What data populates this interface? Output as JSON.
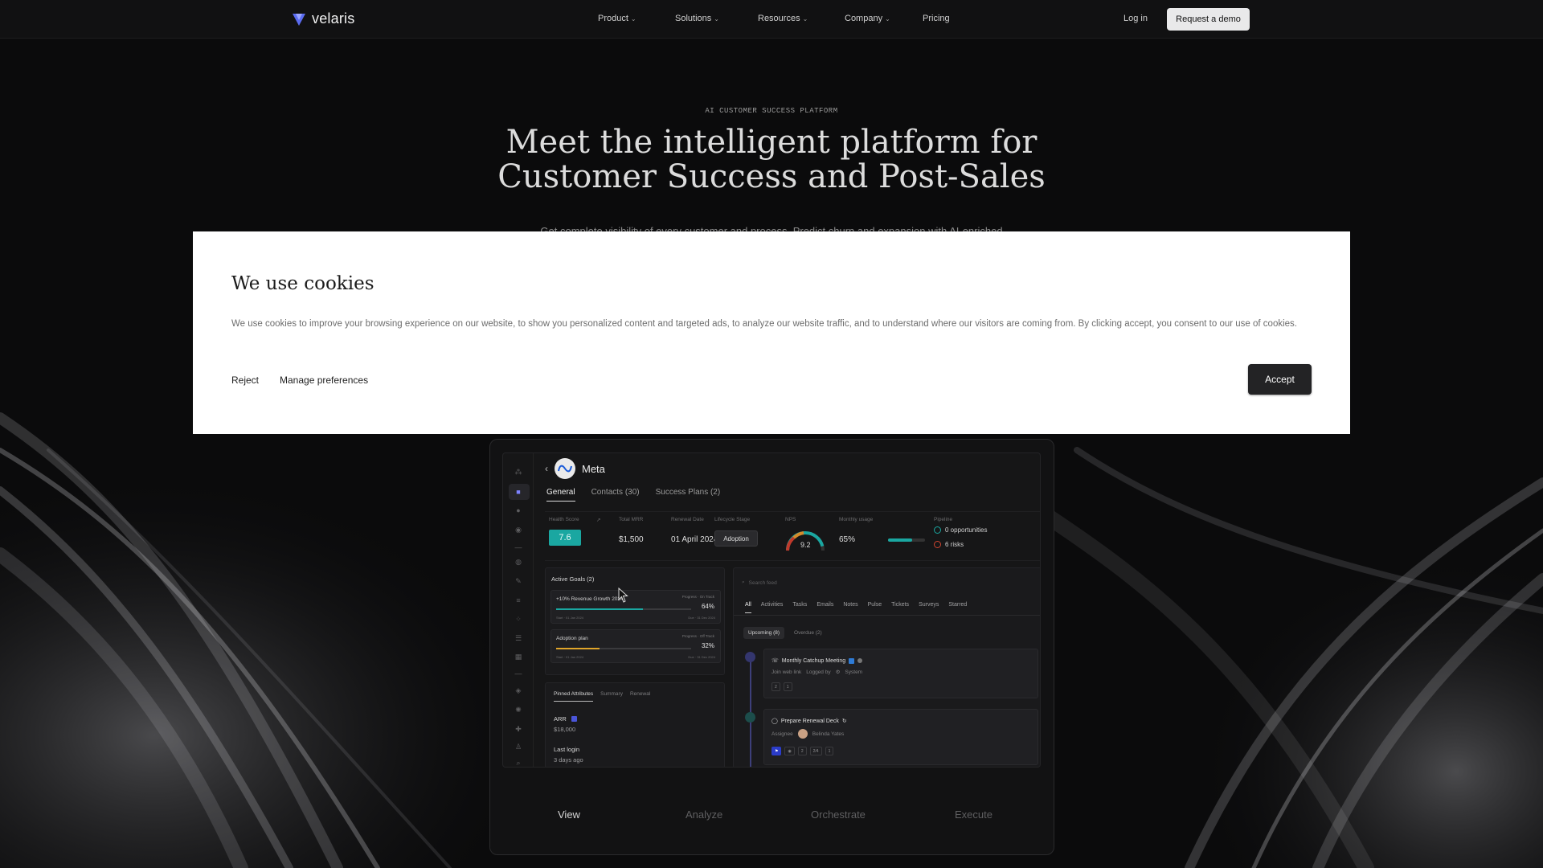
{
  "nav": {
    "brand": "velaris",
    "items": [
      {
        "label": "Product",
        "has_menu": true
      },
      {
        "label": "Solutions",
        "has_menu": true
      },
      {
        "label": "Resources",
        "has_menu": true
      },
      {
        "label": "Company",
        "has_menu": true
      },
      {
        "label": "Pricing",
        "has_menu": false
      }
    ],
    "login": "Log in",
    "cta": "Request a demo",
    "chevron": "⌄"
  },
  "hero": {
    "eyebrow": "AI CUSTOMER SUCCESS PLATFORM",
    "headline_line1": "Meet the intelligent platform for",
    "headline_line2": "Customer Success and Post-Sales",
    "subtext": "Get complete visibility of every customer and process. Predict churn and expansion with AI-enriched"
  },
  "cookie": {
    "title": "We use cookies",
    "body": "We use cookies to improve your browsing experience on our website, to show you personalized content and targeted ads, to analyze our website traffic, and to understand where our visitors are coming from. By clicking accept, you consent to our use of cookies.",
    "reject": "Reject",
    "manage": "Manage preferences",
    "accept": "Accept"
  },
  "app": {
    "back": "‹",
    "account": "Meta",
    "tabs": [
      "General",
      "Contacts (30)",
      "Success Plans (2)"
    ],
    "stats": {
      "health_label": "Health Score",
      "health_value": "7.6",
      "mrr_label": "Total MRR",
      "mrr_value": "$1,500",
      "renewal_label": "Renewal Date",
      "renewal_value": "01 April 2024",
      "stage_label": "Lifecycle Stage",
      "stage_value": "Adoption",
      "nps_label": "NPS",
      "nps_value": "9.2",
      "nps_fraction": 0.92,
      "usage_label": "Monthly usage",
      "usage_value": "65%",
      "usage_fraction": 0.65,
      "pipeline_label": "Pipeline",
      "opportunities": "0 opportunities",
      "risks": "6 risks"
    },
    "goals": {
      "title": "Active Goals (2)",
      "items": [
        {
          "name": "+10% Revenue Growth 2024",
          "progress_label": "Progress · On Track",
          "pct": "64%",
          "fraction": 0.64,
          "color": "#1aa7a1",
          "start": "Start · 01 Jan 2024",
          "due": "Due · 31 Dec 2024"
        },
        {
          "name": "Adoption plan",
          "progress_label": "Progress · Off Track",
          "pct": "32%",
          "fraction": 0.32,
          "color": "#e0a52a",
          "start": "Start · 01 Jan 2024",
          "due": "Due · 31 Dec 2024"
        }
      ]
    },
    "pinned": {
      "tabs": [
        "Pinned Attributes",
        "Summary",
        "Renewal"
      ],
      "attr1_label": "ARR",
      "attr1_value": "$18,000",
      "attr2_label": "Last login",
      "attr2_value": "3 days ago"
    },
    "feed": {
      "search_placeholder": "Search feed",
      "tabs": [
        "All",
        "Activities",
        "Tasks",
        "Emails",
        "Notes",
        "Pulse",
        "Tickets",
        "Surveys",
        "Starred"
      ],
      "subtabs": [
        "Upcoming (8)",
        "Overdue (2)"
      ],
      "event1": {
        "title": "Monthly Catchup Meeting",
        "link": "Join web link",
        "logged_by_label": "Logged by",
        "logged_by": "System",
        "chips": [
          "2",
          "1"
        ]
      },
      "event2": {
        "title": "Prepare Renewal Deck",
        "assignee_label": "Assignee",
        "assignee": "Belinda Yates",
        "chips": [
          "2",
          "2/4",
          "1"
        ]
      }
    }
  },
  "steps": [
    "View",
    "Analyze",
    "Orchestrate",
    "Execute"
  ]
}
